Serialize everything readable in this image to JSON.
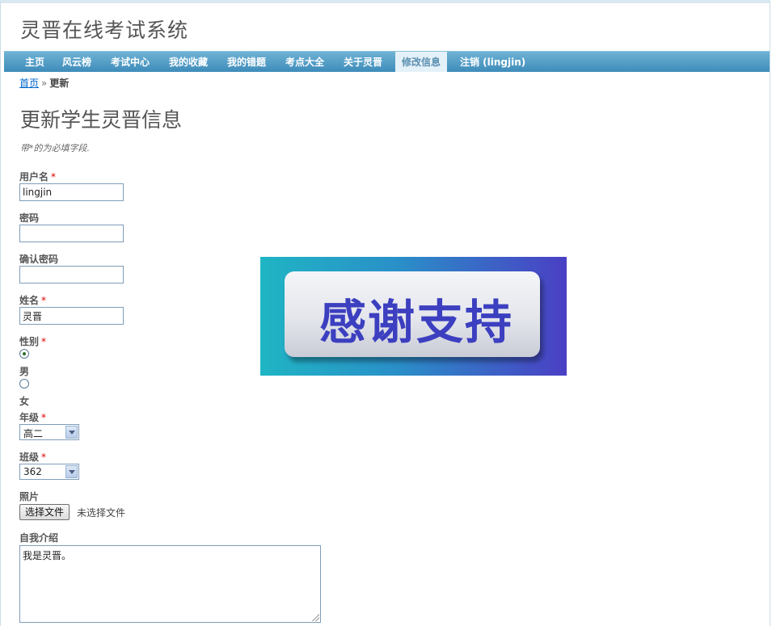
{
  "site": {
    "title": "灵晋在线考试系统"
  },
  "menu": {
    "items": [
      {
        "label": "主页",
        "active": false
      },
      {
        "label": "风云榜",
        "active": false
      },
      {
        "label": "考试中心",
        "active": false
      },
      {
        "label": "我的收藏",
        "active": false
      },
      {
        "label": "我的错题",
        "active": false
      },
      {
        "label": "考点大全",
        "active": false
      },
      {
        "label": "关于灵晋",
        "active": false
      },
      {
        "label": "修改信息",
        "active": true
      },
      {
        "label": "注销 (lingjin)",
        "active": false
      }
    ]
  },
  "breadcrumb": {
    "home": "首页",
    "separator": "»",
    "current": "更新"
  },
  "page": {
    "title": "更新学生灵晋信息",
    "required_note": "带*的为必填字段."
  },
  "form": {
    "username": {
      "label": "用户名",
      "required": "*",
      "value": "lingjin"
    },
    "password": {
      "label": "密码",
      "value": ""
    },
    "confirm_password": {
      "label": "确认密码",
      "value": ""
    },
    "name": {
      "label": "姓名",
      "required": "*",
      "value": "灵晋"
    },
    "gender": {
      "label": "性别",
      "required": "*",
      "options": [
        {
          "label": "男",
          "checked": true
        },
        {
          "label": "女",
          "checked": false
        }
      ]
    },
    "grade": {
      "label": "年级",
      "required": "*",
      "selected": "高二"
    },
    "class": {
      "label": "班级",
      "required": "*",
      "selected": "362"
    },
    "photo": {
      "label": "照片",
      "button": "选择文件",
      "status": "未选择文件"
    },
    "intro": {
      "label": "自我介绍",
      "value": "我是灵晋。"
    }
  },
  "banner": {
    "text": "感谢支持"
  },
  "colors": {
    "menu_bar": "#4f9cc6",
    "menu_active_bg": "#e4f1f8",
    "required": "#dd0000",
    "banner_text": "#3c3fbf"
  }
}
